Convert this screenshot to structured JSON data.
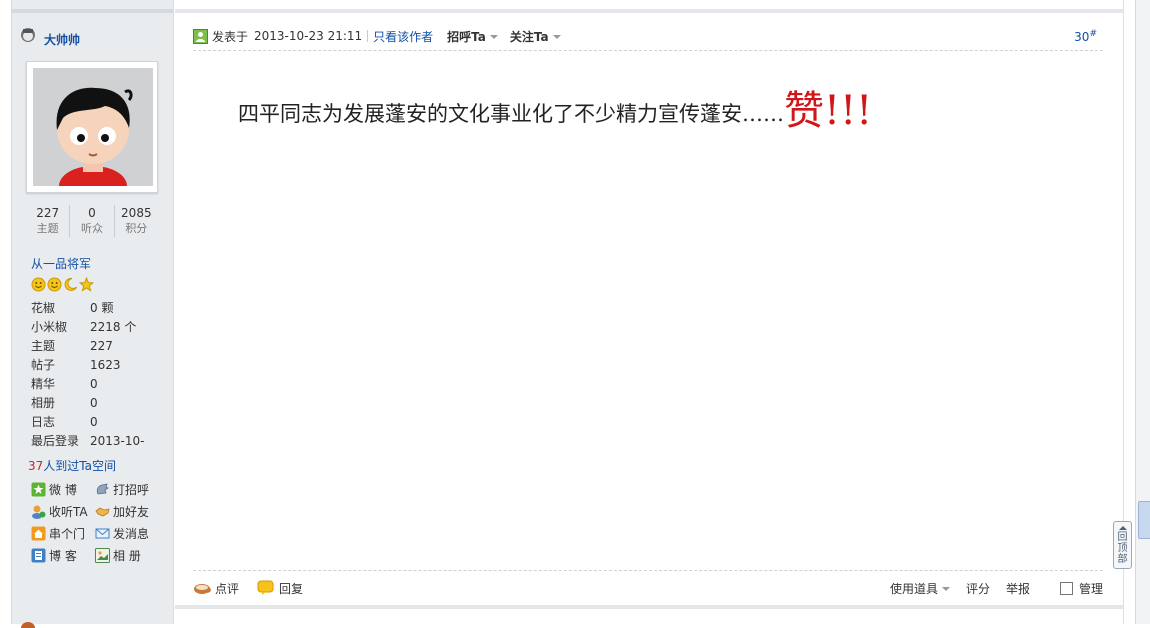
{
  "user": {
    "name": "大帅帅",
    "stats": [
      {
        "value": "227",
        "label": "主题"
      },
      {
        "value": "0",
        "label": "听众"
      },
      {
        "value": "2085",
        "label": "积分"
      }
    ],
    "rank": "从一品将军",
    "info": [
      {
        "label": "花椒",
        "value": "0 颗"
      },
      {
        "label": "小米椒",
        "value": "2218 个"
      },
      {
        "label": "主题",
        "value": "227"
      },
      {
        "label": "帖子",
        "value": "1623"
      },
      {
        "label": "精华",
        "value": "0"
      },
      {
        "label": "相册",
        "value": "0"
      },
      {
        "label": "日志",
        "value": "0"
      },
      {
        "label": "最后登录",
        "value": "2013-10-"
      }
    ],
    "visitors_count": "37",
    "visitors_text": "人到过Ta空间",
    "actions": [
      "微 博",
      "打招呼",
      "收听TA",
      "加好友",
      "串个门",
      "发消息",
      "博 客",
      "相 册"
    ]
  },
  "post": {
    "posted_label": "发表于",
    "timestamp": "2013-10-23 21:11",
    "only_author": "只看该作者",
    "greet": "招呼Ta",
    "follow": "关注Ta",
    "floor": "30",
    "floor_mark": "#",
    "content": "四平同志为发展蓬安的文化事业化了不少精力宣传蓬安……",
    "content_emphasis": "赞!!!",
    "footer": {
      "comment": "点评",
      "reply": "回复",
      "tools": "使用道具",
      "rate": "评分",
      "report": "举报",
      "manage": "管理"
    }
  },
  "back_to_top": "回顶部",
  "colors": {
    "link": "#134fa3",
    "emphasis": "#d1161a",
    "sidebar_bg": "#e9ecef"
  }
}
